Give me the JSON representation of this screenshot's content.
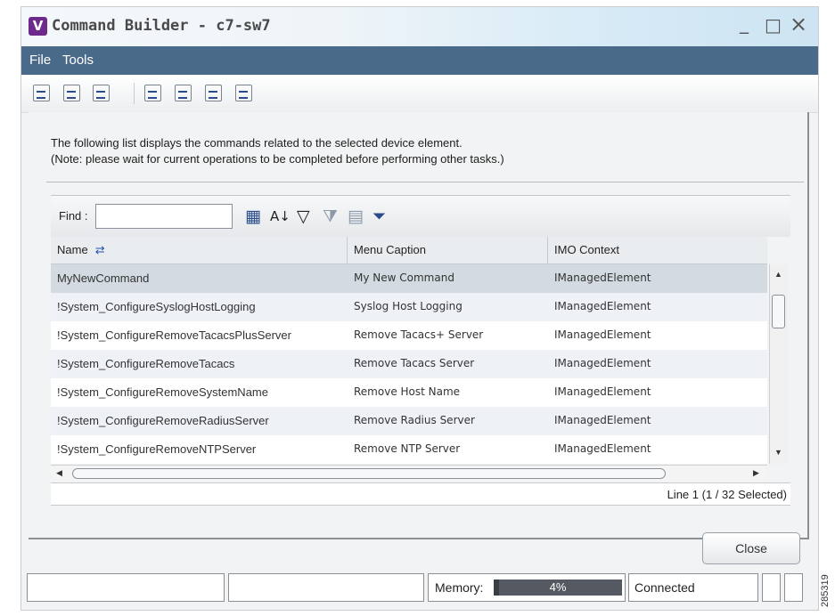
{
  "window": {
    "app_icon_letter": "V",
    "title": "Command Builder - c7-sw7",
    "minimize": "_",
    "maximize": "□",
    "close": "×"
  },
  "menubar": {
    "items": [
      "File",
      "Tools"
    ]
  },
  "toolbar": {
    "icons": [
      "run-command-icon",
      "edit-command-icon",
      "delete-command-icon",
      "import-icon",
      "export-icon",
      "publish-icon",
      "deploy-icon"
    ]
  },
  "description": {
    "line1": "The following list displays the commands related to the selected device element.",
    "line2": "(Note: please wait for current operations to be completed before performing other tasks.)"
  },
  "find": {
    "label": "Find :",
    "value": "",
    "icons": [
      "column-chooser-icon",
      "sort-az-icon",
      "filter-icon",
      "filter-clear-icon",
      "group-icon",
      "advanced-filter-icon"
    ]
  },
  "table": {
    "columns": [
      "Name",
      "Menu Caption",
      "IMO Context"
    ],
    "rows": [
      [
        "MyNewCommand",
        "My New Command",
        "IManagedElement"
      ],
      [
        "!System_ConfigureSyslogHostLogging",
        "Syslog Host Logging",
        "IManagedElement"
      ],
      [
        "!System_ConfigureRemoveTacacsPlusServer",
        "Remove Tacacs+ Server",
        "IManagedElement"
      ],
      [
        "!System_ConfigureRemoveTacacs",
        "Remove Tacacs Server",
        "IManagedElement"
      ],
      [
        "!System_ConfigureRemoveSystemName",
        "Remove Host Name",
        "IManagedElement"
      ],
      [
        "!System_ConfigureRemoveRadiusServer",
        "Remove Radius Server",
        "IManagedElement"
      ],
      [
        "!System_ConfigureRemoveNTPServer",
        "Remove NTP Server",
        "IManagedElement"
      ]
    ],
    "selected_row": 0,
    "status": "Line 1 (1 / 32 Selected)"
  },
  "buttons": {
    "close": "Close"
  },
  "statusbar": {
    "memory_label": "Memory:",
    "memory_percent": "4%",
    "memory_fraction": 0.04,
    "connection": "Connected"
  },
  "figure_code": "285319"
}
